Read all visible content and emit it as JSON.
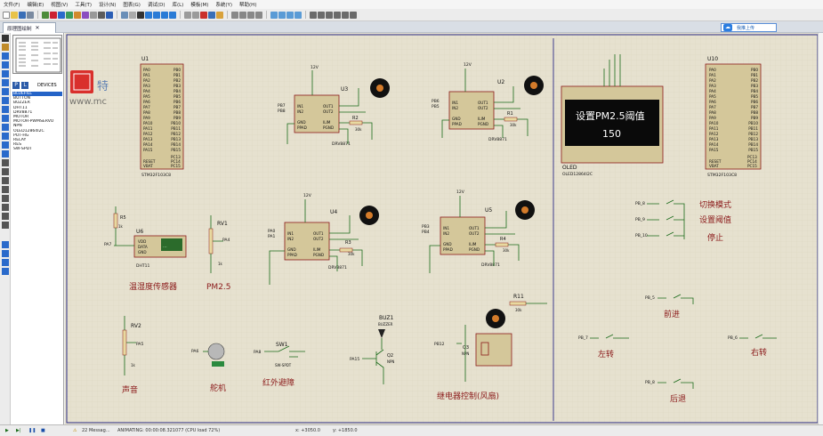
{
  "menu": [
    "文件(F)",
    "编辑(E)",
    "视图(V)",
    "工具(T)",
    "设计(N)",
    "图表(G)",
    "调试(D)",
    "库(L)",
    "模板(M)",
    "系统(Y)",
    "帮助(H)"
  ],
  "tab": {
    "title": "原理图绘制"
  },
  "upload": {
    "label": "我推上传"
  },
  "devices": {
    "tabs": [
      "P",
      "L"
    ],
    "header": "DEVICES",
    "items": [
      "BLUEFILL",
      "BUTTON",
      "BUZZER",
      "DHT11",
      "DRV8871",
      "MOTOR",
      "MOTOR-PWMSERVO",
      "NPN",
      "OLED12864I2C",
      "POT-HG",
      "RELAY",
      "RES",
      "SW-SPDT"
    ],
    "selected": "BLUEFILL"
  },
  "watermark": {
    "text": "特",
    "url": "www.mc"
  },
  "components": {
    "u1": {
      "ref": "U1",
      "part": "STM32F103C8",
      "left": [
        "PA0",
        "PA1",
        "PA2",
        "PA3",
        "PA4",
        "PA5",
        "PA6",
        "PA7",
        "PA8",
        "PA9",
        "PA10",
        "PA11",
        "PA12",
        "PA13",
        "PA14",
        "PA15"
      ],
      "right": [
        "PB0",
        "PB1",
        "PB2",
        "PB3",
        "PB4",
        "PB5",
        "PB6",
        "PB7",
        "PB8",
        "PB9",
        "PB10",
        "PB11",
        "PB12",
        "PB13",
        "PB14",
        "PB15"
      ],
      "bottom_left": [
        "RESET",
        "VBAT"
      ],
      "bottom_right": [
        "PC13",
        "PC14",
        "PC15"
      ]
    },
    "u10": {
      "ref": "U10",
      "part": "STM32F103C8",
      "left": [
        "PA0",
        "PA1",
        "PA2",
        "PA3",
        "PA4",
        "PA5",
        "PA6",
        "PA7",
        "PA8",
        "PA9",
        "PA10",
        "PA11",
        "PA12",
        "PA13",
        "PA14",
        "PA15"
      ],
      "right": [
        "PB0",
        "PB1",
        "PB2",
        "PB3",
        "PB4",
        "PB5",
        "PB6",
        "PB7",
        "PB8",
        "PB9",
        "PB10",
        "PB11",
        "PB12",
        "PB13",
        "PB14",
        "PB15"
      ],
      "bottom_left": [
        "RESET",
        "VBAT"
      ],
      "bottom_right": [
        "PC13",
        "PC14",
        "PC15"
      ]
    },
    "u3": {
      "ref": "U3",
      "part": "DRV8871",
      "vcc": "12V",
      "in1": "PB7",
      "in2": "PB8",
      "res": "R2",
      "rval": "30k"
    },
    "u2": {
      "ref": "U2",
      "part": "DRV8871",
      "vcc": "12V",
      "in1": "PB6",
      "in2": "PB5",
      "res": "R1",
      "rval": "30k"
    },
    "u4": {
      "ref": "U4",
      "part": "DRV8871",
      "vcc": "12V",
      "in1": "PA0",
      "in2": "PA1",
      "res": "R3",
      "rval": "30k"
    },
    "u5": {
      "ref": "U5",
      "part": "DRV8871",
      "vcc": "12V",
      "in1": "PB3",
      "in2": "PB4",
      "res": "R4",
      "rval": "30k"
    },
    "oled": {
      "ref": "OLED",
      "part": "OLED12864I2C",
      "line1": "设置PM2.5阈值",
      "line2": "150"
    },
    "u6": {
      "ref": "U6",
      "part": "DHT11",
      "res": "R5",
      "rval": "1k",
      "net": "PA7",
      "reading": "..."
    },
    "rv1": {
      "ref": "RV1",
      "net": "PA4",
      "val": "1k"
    },
    "rv2": {
      "ref": "RV2",
      "net": "PA5",
      "val": "1k"
    },
    "servo": {
      "net": "PA6"
    },
    "sw1": {
      "ref": "SW1",
      "net": "PA8",
      "part": "SW-SPDT"
    },
    "buz1": {
      "ref": "BUZ1",
      "part": "BUZZER",
      "q": "Q2",
      "qpart": "NPN",
      "net": "PA15"
    },
    "relay": {
      "res": "R11",
      "rval": "30k",
      "q": "Q3",
      "qpart": "NPN",
      "net": "PB12"
    },
    "buttons_right": [
      {
        "net": "PB_8",
        "label": "切换模式"
      },
      {
        "net": "PB_9",
        "label": "设置阈值"
      },
      {
        "net": "PB_10",
        "label": "停止"
      }
    ],
    "dir_buttons": [
      {
        "net": "PB_5",
        "label": "前进"
      },
      {
        "net": "PB_7",
        "label": "左转"
      },
      {
        "net": "PB_6",
        "label": "右转"
      },
      {
        "net": "PB_8",
        "label": "后退"
      }
    ]
  },
  "labels": {
    "temp": "温湿度传感器",
    "pm25": "PM2.5",
    "sound": "声音",
    "servo": "舵机",
    "ir": "红外避障",
    "relay": "继电器控制(风扇)"
  },
  "status": {
    "msgs": "22 Messag...",
    "anim": "ANIMATING: 00:00:08.321077 (CPU load 72%)",
    "x": "x: +3050.0",
    "y": "y: +1850.0"
  }
}
